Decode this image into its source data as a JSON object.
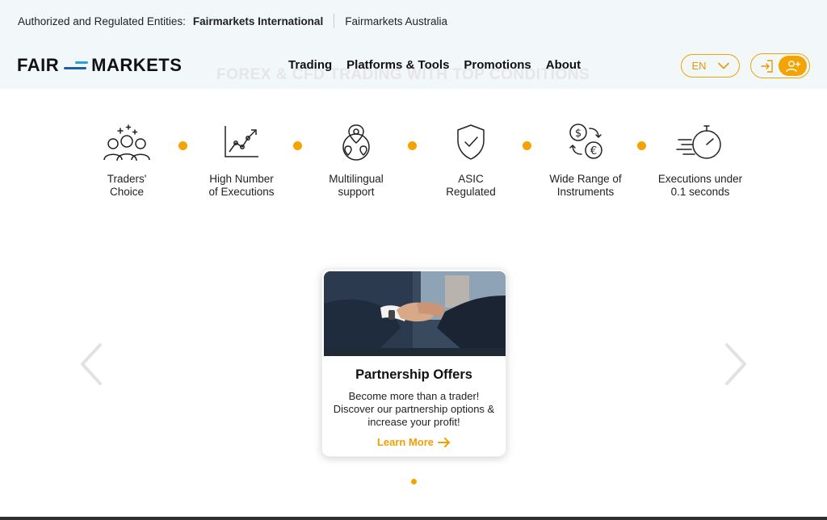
{
  "entities": {
    "label": "Authorized and Regulated Entities:",
    "items": [
      {
        "name": "Fairmarkets International",
        "active": true
      },
      {
        "name": "Fairmarkets Australia",
        "active": false
      }
    ]
  },
  "logo": {
    "left": "FAIR",
    "right": "MARKETS"
  },
  "watermark": "FOREX & CFD TRADING WITH TOP CONDITIONS",
  "nav": [
    "Trading",
    "Platforms & Tools",
    "Promotions",
    "About"
  ],
  "language": {
    "selected": "EN"
  },
  "auth": {
    "login_icon": "login-icon",
    "register_icon": "add-user-icon"
  },
  "features": [
    {
      "icon": "traders-icon",
      "caption": [
        "Traders'",
        "Choice"
      ]
    },
    {
      "icon": "chart-icon",
      "caption": [
        "High Number",
        "of Executions"
      ]
    },
    {
      "icon": "location-pins-icon",
      "caption": [
        "Multilingual",
        "support"
      ]
    },
    {
      "icon": "shield-check-icon",
      "caption": [
        "ASIC",
        "Regulated"
      ]
    },
    {
      "icon": "currency-exchange-icon",
      "caption": [
        "Wide Range of",
        "Instruments"
      ]
    },
    {
      "icon": "stopwatch-speed-icon",
      "caption": [
        "Executions under",
        "0.1 seconds"
      ]
    }
  ],
  "card": {
    "title": "Partnership Offers",
    "desc": "Become more than a trader! Discover our partnership options & increase your profit!",
    "link": "Learn More"
  },
  "colors": {
    "accent": "#f5a300",
    "topbar": "#f2f7fa",
    "logo_blue": "#1b5fa8",
    "logo_light_blue": "#2a9fe0"
  }
}
